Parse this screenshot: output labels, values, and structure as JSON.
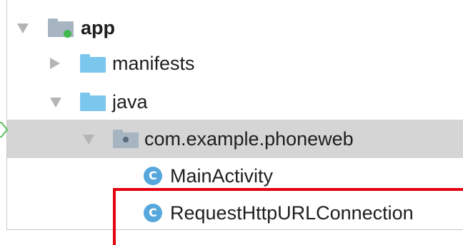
{
  "tree": {
    "items": [
      {
        "label": "app",
        "icon": "module-folder-icon",
        "expanded": true,
        "depth": 0
      },
      {
        "label": "manifests",
        "icon": "folder-icon",
        "expanded": false,
        "depth": 1
      },
      {
        "label": "java",
        "icon": "folder-icon",
        "expanded": true,
        "depth": 1
      },
      {
        "label": "com.example.phoneweb",
        "icon": "package-icon",
        "expanded": true,
        "depth": 2,
        "selected": true
      },
      {
        "label": "MainActivity",
        "icon": "class-icon",
        "depth": 3
      },
      {
        "label": "RequestHttpURLConnection",
        "icon": "class-icon",
        "depth": 3,
        "highlighted": true
      }
    ],
    "class_icon_letter": "C"
  },
  "colors": {
    "selection": "#d5d5d5",
    "highlight_border": "#e3000f",
    "folder_blue": "#7bc6ec",
    "class_icon": "#56a7dc"
  }
}
